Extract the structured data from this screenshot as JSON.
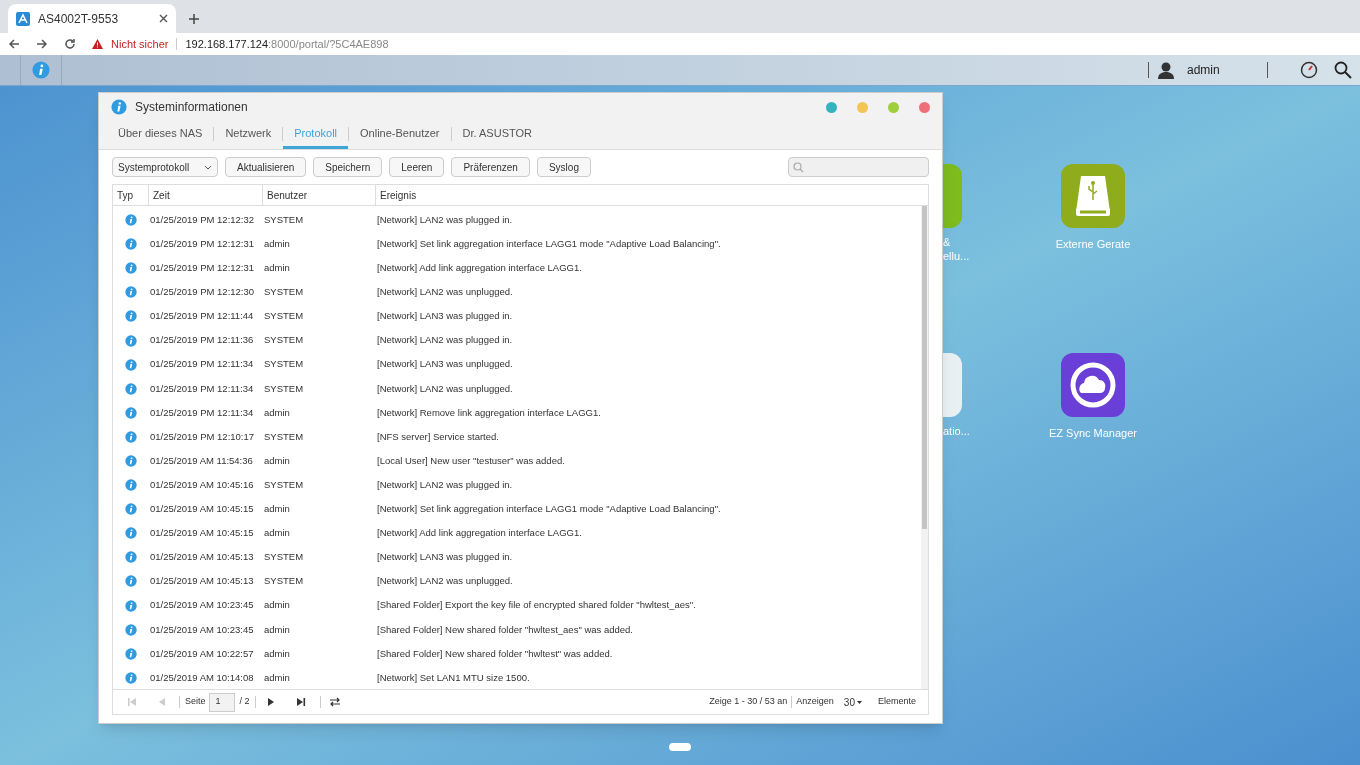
{
  "browser": {
    "tab_title": "AS4002T-9553",
    "security": "Nicht sicher",
    "url_host": "192.168.177.124",
    "url_rest": ":8000/portal/?5C4AE898"
  },
  "topbar": {
    "user": "admin"
  },
  "desktop_icons": [
    {
      "kind": "partial",
      "label_lines": [
        "&",
        "ellu..."
      ],
      "color": "#7dbb1f"
    },
    {
      "kind": "usb",
      "label_lines": [
        "Externe Gerate"
      ],
      "color": "#8fac1c"
    },
    {
      "kind": "partial",
      "label_lines": [
        "atio..."
      ],
      "color": "#e9f0f3"
    },
    {
      "kind": "sync",
      "label_lines": [
        "EZ Sync Manager"
      ],
      "color": "#6a3fd8"
    }
  ],
  "window": {
    "title": "Systeminformationen",
    "controls": [
      {
        "color": "#35b3bf"
      },
      {
        "color": "#f3c554"
      },
      {
        "color": "#9fcf3c"
      },
      {
        "color": "#ef6f7b"
      }
    ],
    "tabs": [
      {
        "label": "Über dieses NAS",
        "selected": false
      },
      {
        "label": "Netzwerk",
        "selected": false
      },
      {
        "label": "Protokoll",
        "selected": true
      },
      {
        "label": "Online-Benutzer",
        "selected": false
      },
      {
        "label": "Dr. ASUSTOR",
        "selected": false
      }
    ],
    "log_type": "Systemprotokoll",
    "buttons": [
      "Aktualisieren",
      "Speichern",
      "Leeren",
      "Präferenzen",
      "Syslog"
    ],
    "table": {
      "columns": [
        "Typ",
        "Zeit",
        "Benutzer",
        "Ereignis"
      ],
      "rows": [
        {
          "kind": "info",
          "time": "01/25/2019 PM 12:12:32",
          "user": "SYSTEM",
          "event": "[Network] LAN2 was plugged in."
        },
        {
          "kind": "info",
          "time": "01/25/2019 PM 12:12:31",
          "user": "admin",
          "event": "[Network] Set link aggregation interface LAGG1 mode \"Adaptive Load Balancing\"."
        },
        {
          "kind": "info",
          "time": "01/25/2019 PM 12:12:31",
          "user": "admin",
          "event": "[Network] Add link aggregation interface LAGG1."
        },
        {
          "kind": "info",
          "time": "01/25/2019 PM 12:12:30",
          "user": "SYSTEM",
          "event": "[Network] LAN2 was unplugged."
        },
        {
          "kind": "info",
          "time": "01/25/2019 PM 12:11:44",
          "user": "SYSTEM",
          "event": "[Network] LAN3 was plugged in."
        },
        {
          "kind": "info",
          "time": "01/25/2019 PM 12:11:36",
          "user": "SYSTEM",
          "event": "[Network] LAN2 was plugged in."
        },
        {
          "kind": "info",
          "time": "01/25/2019 PM 12:11:34",
          "user": "SYSTEM",
          "event": "[Network] LAN3 was unplugged."
        },
        {
          "kind": "info",
          "time": "01/25/2019 PM 12:11:34",
          "user": "SYSTEM",
          "event": "[Network] LAN2 was unplugged."
        },
        {
          "kind": "info",
          "time": "01/25/2019 PM 12:11:34",
          "user": "admin",
          "event": "[Network] Remove link aggregation interface LAGG1."
        },
        {
          "kind": "info",
          "time": "01/25/2019 PM 12:10:17",
          "user": "SYSTEM",
          "event": "[NFS server] Service started."
        },
        {
          "kind": "info",
          "time": "01/25/2019 AM 11:54:36",
          "user": "admin",
          "event": "[Local User] New user \"testuser\" was added."
        },
        {
          "kind": "info",
          "time": "01/25/2019 AM 10:45:16",
          "user": "SYSTEM",
          "event": "[Network] LAN2 was plugged in."
        },
        {
          "kind": "info",
          "time": "01/25/2019 AM 10:45:15",
          "user": "admin",
          "event": "[Network] Set link aggregation interface LAGG1 mode \"Adaptive Load Balancing\"."
        },
        {
          "kind": "info",
          "time": "01/25/2019 AM 10:45:15",
          "user": "admin",
          "event": "[Network] Add link aggregation interface LAGG1."
        },
        {
          "kind": "info",
          "time": "01/25/2019 AM 10:45:13",
          "user": "SYSTEM",
          "event": "[Network] LAN3 was plugged in."
        },
        {
          "kind": "info",
          "time": "01/25/2019 AM 10:45:13",
          "user": "SYSTEM",
          "event": "[Network] LAN2 was unplugged."
        },
        {
          "kind": "info",
          "time": "01/25/2019 AM 10:23:45",
          "user": "admin",
          "event": "[Shared Folder] Export the key file of encrypted shared folder \"hwltest_aes\"."
        },
        {
          "kind": "info",
          "time": "01/25/2019 AM 10:23:45",
          "user": "admin",
          "event": "[Shared Folder] New shared folder \"hwltest_aes\" was added."
        },
        {
          "kind": "info",
          "time": "01/25/2019 AM 10:22:57",
          "user": "admin",
          "event": "[Shared Folder] New shared folder \"hwltest\" was added."
        },
        {
          "kind": "info",
          "time": "01/25/2019 AM 10:14:08",
          "user": "admin",
          "event": "[Network] Set LAN1 MTU size 1500."
        }
      ]
    },
    "pager": {
      "first_disabled": true,
      "prev_disabled": true,
      "page_label": "Seite",
      "page": "1",
      "page_total": "/ 2",
      "summary": "Zeige 1 - 30 / 53 an",
      "show_label": "Anzeigen",
      "per_page": "30",
      "items_label": "Elemente"
    }
  }
}
